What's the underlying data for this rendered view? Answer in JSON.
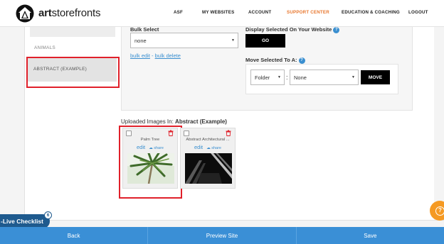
{
  "brand": {
    "name_bold": "art",
    "name_rest": "storefronts"
  },
  "nav": {
    "items": [
      {
        "label": "ASF",
        "active": false
      },
      {
        "label": "MY WEBSITES",
        "active": false
      },
      {
        "label": "ACCOUNT",
        "active": false
      },
      {
        "label": "SUPPORT CENTER",
        "active": true
      },
      {
        "label": "EDUCATION & COACHING",
        "active": false
      },
      {
        "label": "LOGOUT",
        "active": false
      }
    ],
    "active_color": "#e8772e"
  },
  "sidebar": {
    "items": [
      {
        "label": "ANIMALS"
      },
      {
        "label": "ABSTRACT (EXAMPLE)",
        "selected": true
      }
    ]
  },
  "bulk": {
    "label": "Bulk Select",
    "select_value": "none",
    "link_edit": "bulk edit",
    "link_sep": " - ",
    "link_delete": "bulk delete"
  },
  "display": {
    "label": "Display Selected On Your Website",
    "go_button": "GO"
  },
  "move": {
    "label": "Move Selected To A:",
    "type_value": "Folder",
    "separator": ":",
    "target_value": "None",
    "move_button": "MOVE"
  },
  "uploaded": {
    "prefix": "Uploaded Images In: ",
    "folder": "Abstract (Example)",
    "images": [
      {
        "title": "Palm Tree",
        "edit": "edit",
        "share": "share"
      },
      {
        "title": "Abstract Architectural ...",
        "edit": "edit",
        "share": "share"
      }
    ]
  },
  "checklist": {
    "label": "-Live Checklist",
    "badge": "6"
  },
  "help_fab": {
    "glyph": "?"
  },
  "bottom": {
    "back": "Back",
    "preview": "Preview Site",
    "save": "Save"
  },
  "colors": {
    "accent_blue": "#3a8fd6",
    "link_blue": "#3a8fd0",
    "highlight_red": "#e0202a",
    "checklist_blue": "#1e5a8e",
    "help_orange": "#f59a23"
  }
}
